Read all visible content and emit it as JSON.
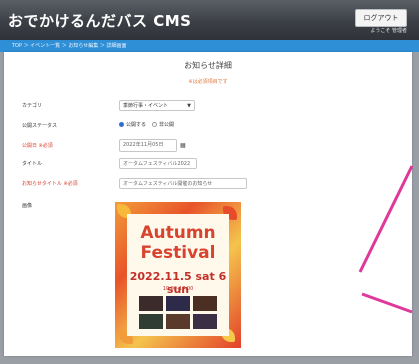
{
  "header": {
    "title": "おでかけるんだバス CMS",
    "logout_label": "ログアウト",
    "logout_sub": "ようこそ 管理者"
  },
  "breadcrumb": "TOP ＞ イベント一覧 ＞ お知らせ編集 ＞ 詳細画面",
  "page": {
    "title": "お知らせ詳細",
    "required_note": "※は必須項目です"
  },
  "form": {
    "category": {
      "label": "カテゴリ",
      "value": "季節行事・イベント"
    },
    "visibility": {
      "label": "公開ステータス",
      "on_label": "公開する",
      "off_label": "非公開"
    },
    "publish_date": {
      "label": "公開日 ※必須",
      "value": "2022年11月05日"
    },
    "title": {
      "label": "タイトル",
      "value": "オータムフェスティバル2022"
    },
    "detail_title": {
      "label": "お知らせタイトル ※必須",
      "value": "オータムフェスティバル開催のお知らせ"
    },
    "image": {
      "label": "画像"
    }
  },
  "poster": {
    "title_line1": "Autumn",
    "title_line2": "Festival",
    "date": "2022.11.5 sat 6 sun",
    "time": "10:00-17:00"
  },
  "colors": {
    "header": "#3c4046",
    "breadcrumb": "#2f8fd6",
    "required": "#d8432f",
    "annotation": "#e0379a"
  }
}
